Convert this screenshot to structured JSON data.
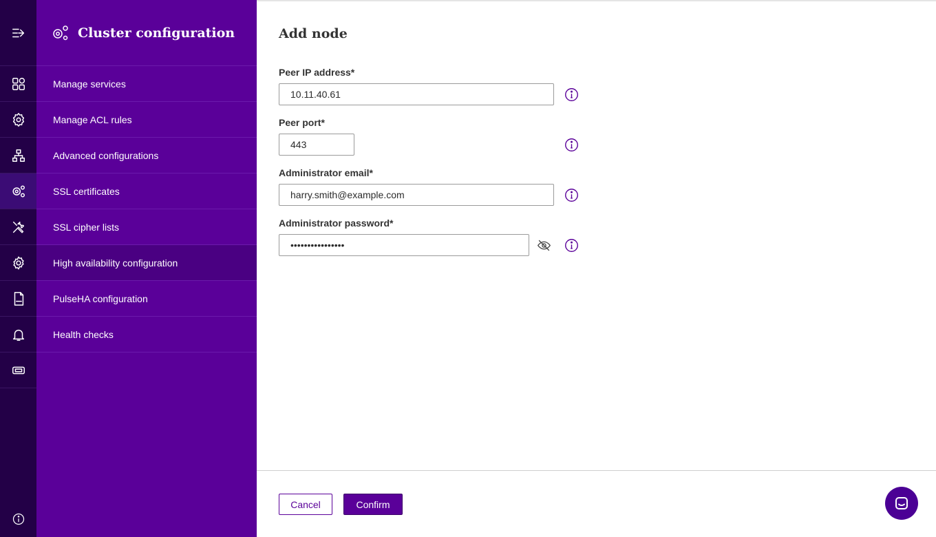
{
  "sidebar": {
    "title": "Cluster configuration",
    "items": [
      {
        "label": "Manage services",
        "icon": "grid-icon"
      },
      {
        "label": "Manage ACL rules",
        "icon": "shield-gear-icon"
      },
      {
        "label": "Advanced configurations",
        "icon": "network-icon"
      },
      {
        "label": "SSL certificates",
        "icon": "gears-icon"
      },
      {
        "label": "SSL cipher lists",
        "icon": "tools-icon"
      },
      {
        "label": "High availability configuration",
        "icon": "gear-icon"
      },
      {
        "label": "PulseHA configuration",
        "icon": "log-file-icon"
      },
      {
        "label": "Health checks",
        "icon": "bell-icon"
      }
    ],
    "active_index": 5
  },
  "main": {
    "title": "Add node",
    "fields": {
      "peer_ip": {
        "label": "Peer IP address*",
        "value": "10.11.40.61"
      },
      "peer_port": {
        "label": "Peer port*",
        "value": "443"
      },
      "admin_email": {
        "label": "Administrator email*",
        "value": "harry.smith@example.com"
      },
      "admin_password": {
        "label": "Administrator password*",
        "value": "••••••••••••••••"
      }
    }
  },
  "footer": {
    "cancel_label": "Cancel",
    "confirm_label": "Confirm"
  },
  "colors": {
    "rail": "#230047",
    "sidebar": "#5a0099",
    "accent": "#5a0099",
    "active_item": "#4a0082"
  }
}
